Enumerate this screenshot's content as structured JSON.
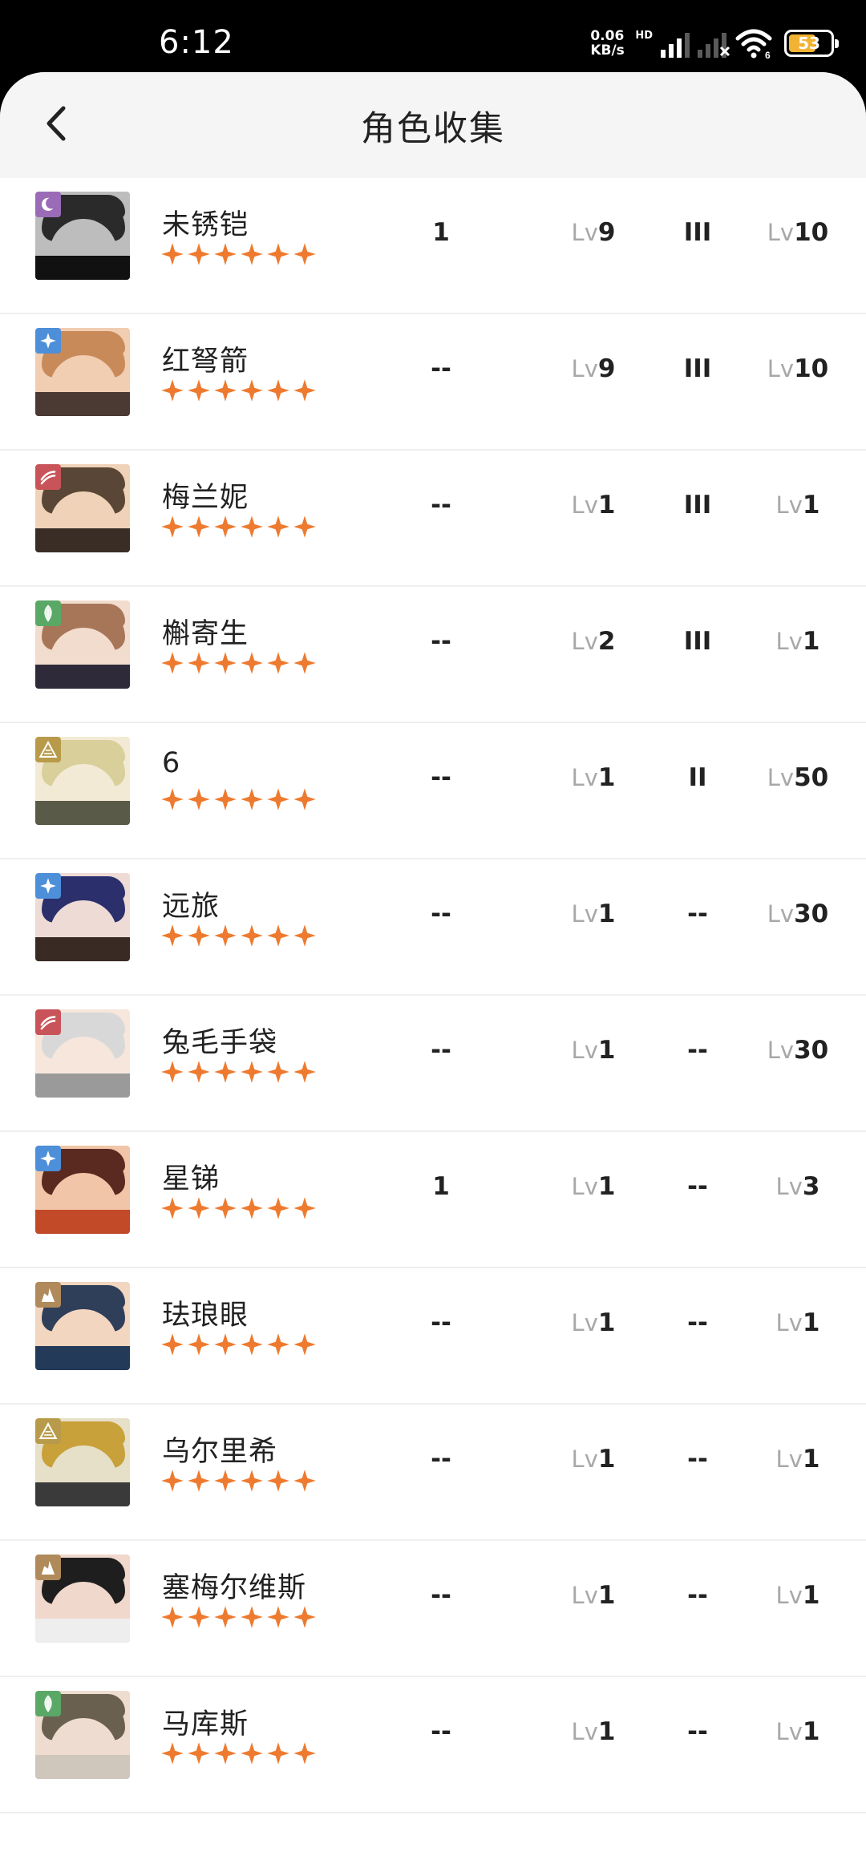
{
  "status_bar": {
    "time": "6:12",
    "net_speed_value": "0.06",
    "net_speed_unit": "KB/s",
    "hd_label": "HD",
    "battery": "53"
  },
  "header": {
    "title": "角色收集"
  },
  "characters": [
    {
      "name": "未锈铠",
      "col1": "1",
      "level": "9",
      "insight": "III",
      "psychube_level": "10",
      "afflatus": "spirit"
    },
    {
      "name": "红弩箭",
      "col1": "--",
      "level": "9",
      "insight": "III",
      "psychube_level": "10",
      "afflatus": "star"
    },
    {
      "name": "梅兰妮",
      "col1": "--",
      "level": "1",
      "insight": "III",
      "psychube_level": "1",
      "afflatus": "beast"
    },
    {
      "name": "槲寄生",
      "col1": "--",
      "level": "2",
      "insight": "III",
      "psychube_level": "1",
      "afflatus": "plant"
    },
    {
      "name": "6",
      "col1": "--",
      "level": "1",
      "insight": "II",
      "psychube_level": "50",
      "afflatus": "intellect"
    },
    {
      "name": "远旅",
      "col1": "--",
      "level": "1",
      "insight": "--",
      "psychube_level": "30",
      "afflatus": "star"
    },
    {
      "name": "兔毛手袋",
      "col1": "--",
      "level": "1",
      "insight": "--",
      "psychube_level": "30",
      "afflatus": "beast"
    },
    {
      "name": "星锑",
      "col1": "1",
      "level": "1",
      "insight": "--",
      "psychube_level": "3",
      "afflatus": "star"
    },
    {
      "name": "珐琅眼",
      "col1": "--",
      "level": "1",
      "insight": "--",
      "psychube_level": "1",
      "afflatus": "mineral"
    },
    {
      "name": "乌尔里希",
      "col1": "--",
      "level": "1",
      "insight": "--",
      "psychube_level": "1",
      "afflatus": "intellect"
    },
    {
      "name": "塞梅尔维斯",
      "col1": "--",
      "level": "1",
      "insight": "--",
      "psychube_level": "1",
      "afflatus": "mineral"
    },
    {
      "name": "马库斯",
      "col1": "--",
      "level": "1",
      "insight": "--",
      "psychube_level": "1",
      "afflatus": "plant"
    }
  ],
  "labels": {
    "lv_prefix": "Lv"
  },
  "rarity_stars": 6,
  "colors": {
    "star": "#ee7a2f",
    "spirit": "#9a6bb6",
    "star_afflatus": "#4d8fd8",
    "beast": "#c8545a",
    "plant": "#5aa866",
    "intellect": "#b89b4a",
    "mineral": "#b08a5a"
  }
}
